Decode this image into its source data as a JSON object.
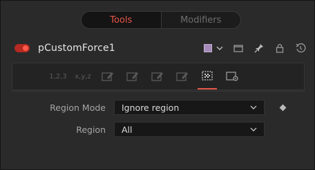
{
  "tabs": [
    {
      "label": "Tools",
      "active": true
    },
    {
      "label": "Modifiers",
      "active": false
    }
  ],
  "tool": {
    "name": "pCustomForce1",
    "color": "#a58bb8"
  },
  "toolbar": {
    "buttons": [
      {
        "label": "1,2,3",
        "icon": "numbers-icon"
      },
      {
        "label": "x,y,z",
        "icon": "xyz-icon"
      },
      {
        "icon": "edit-graph-icon"
      },
      {
        "icon": "edit-graph-icon"
      },
      {
        "icon": "edit-graph-icon"
      },
      {
        "icon": "edit-graph-icon"
      },
      {
        "icon": "region-icon",
        "active": true
      },
      {
        "icon": "settings-icon"
      }
    ]
  },
  "fields": {
    "region_mode": {
      "label": "Region Mode",
      "value": "Ignore region"
    },
    "region": {
      "label": "Region",
      "value": "All"
    }
  },
  "colors": {
    "accent": "#e8574a",
    "background": "#2a2a2a"
  }
}
